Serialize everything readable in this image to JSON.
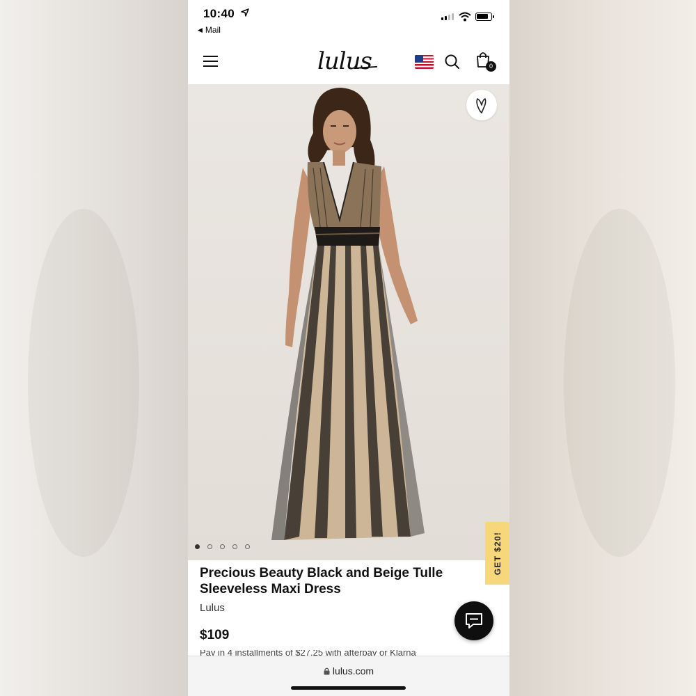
{
  "status_bar": {
    "time": "10:40",
    "back_app": "Mail"
  },
  "header": {
    "logo": "lulus",
    "cart_count": "0",
    "icons": [
      "menu-icon",
      "us-flag-icon",
      "search-icon",
      "shopping-bag-icon"
    ]
  },
  "gallery": {
    "image_count": 5,
    "active_index": 0,
    "favorite_icon": "heart-icon"
  },
  "promo": {
    "label": "GET $20!",
    "color": "#f6d77c"
  },
  "product": {
    "title": "Precious Beauty Black and Beige Tulle Sleeveless Maxi Dress",
    "brand": "Lulus",
    "price": "$109",
    "installments": "Pay in 4 installments of $27.25 with afterpay or Klarna"
  },
  "browser": {
    "url": "lulus.com"
  }
}
